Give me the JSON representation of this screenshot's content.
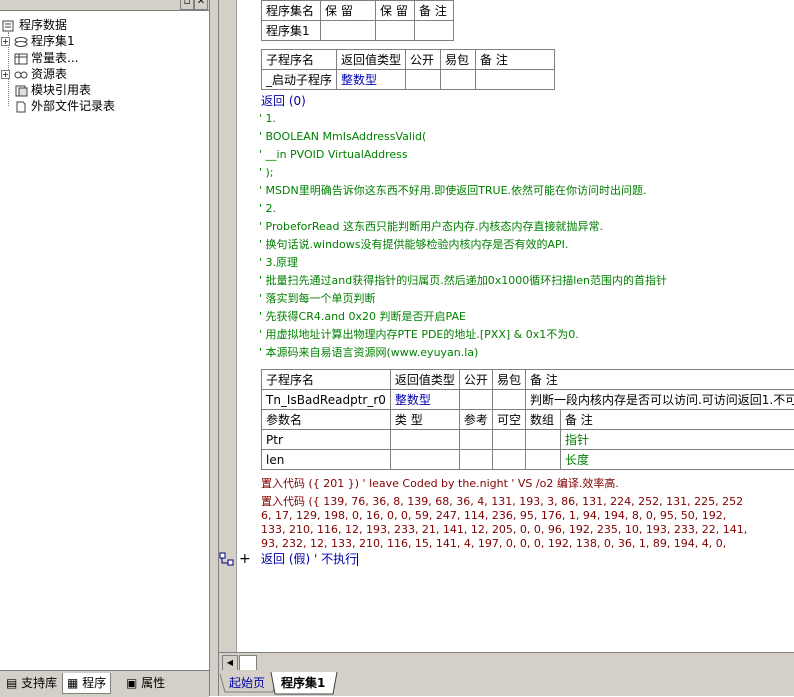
{
  "tree": {
    "root": "程序数据",
    "items": [
      {
        "label": "程序集1",
        "icon": "program-set-icon",
        "expander": "+"
      },
      {
        "label": "常量表...",
        "icon": "constant-table-icon",
        "expander": ""
      },
      {
        "label": "资源表",
        "icon": "resource-table-icon",
        "expander": "+"
      },
      {
        "label": "模块引用表",
        "icon": "module-ref-icon",
        "expander": ""
      },
      {
        "label": "外部文件记录表",
        "icon": "external-file-icon",
        "expander": ""
      }
    ]
  },
  "left_tabs": [
    "支持库",
    "程序",
    "属性"
  ],
  "assembly_table": {
    "headers": [
      "程序集名",
      "保 留",
      "保 留",
      "备 注"
    ],
    "row": [
      "程序集1",
      "",
      "",
      ""
    ]
  },
  "sub1_table": {
    "headers": [
      "子程序名",
      "返回值类型",
      "公开",
      "易包",
      "备 注"
    ],
    "row": [
      "_启动子程序",
      "整数型",
      "",
      "",
      ""
    ]
  },
  "return_line": "返回 (0)",
  "comments": [
    "' 1.",
    "' BOOLEAN MmIsAddressValid(",
    "' __in  PVOID VirtualAddress",
    "' );",
    "' MSDN里明确告诉你这东西不好用.即使返回TRUE.依然可能在你访问时出问题.",
    "' 2.",
    "' ProbeforRead 这东西只能判断用户态内存.内核态内存直接就抛异常.",
    "' 换句话说.windows没有提供能够检验内核内存是否有效的API.",
    "' 3.原理",
    "' 批量扫先通过and获得指针的归属页.然后递加0x1000循环扫描len范围内的首指针",
    "' 落实到每一个单页判断",
    "' 先获得CR4.and 0x20 判断是否开启PAE",
    "' 用虚拟地址计算出物理内存PTE PDE的地址.[PXX] & 0x1不为0.",
    "' 本源码来自易语言资源网(www.eyuyan.la)"
  ],
  "sub2_table": {
    "headers": [
      "子程序名",
      "返回值类型",
      "公开",
      "易包",
      "备 注"
    ],
    "row": [
      "Tn_IsBadReadptr_r0",
      "整数型",
      "",
      "",
      "判断一段内核内存是否可以访问.可访问返回1.不可"
    ],
    "param_headers": [
      "参数名",
      "类 型",
      "参考",
      "可空",
      "数组",
      "备 注"
    ],
    "params": [
      [
        "Ptr",
        "",
        "",
        "",
        "",
        "指针"
      ],
      [
        "len",
        "",
        "",
        "",
        "",
        "长度"
      ]
    ]
  },
  "code": {
    "line1": "置入代码 ({ 201 })  ' leave   Coded by the.night ' VS /o2 编译.效率高.",
    "line2": "置入代码 ({ 139, 76, 36, 8, 139, 68, 36, 4, 131, 193, 3, 86, 131, 224, 252, 131, 225, 252",
    "line3": "6, 17, 129, 198, 0, 16, 0, 0, 59, 247, 114, 236, 95, 176, 1, 94, 194, 8, 0, 95, 50, 192,",
    "line4": "133, 210, 116, 12, 193, 233, 21, 141, 12, 205, 0, 0, 96, 192, 235, 10, 193, 233, 22, 141,",
    "line5": "93, 232, 12, 133, 210, 116, 15, 141, 4, 197, 0, 0, 0, 192, 138, 0, 36, 1, 89, 194, 4, 0,"
  },
  "final_line": "返回 (假)  ' 不执行",
  "doc_tabs": [
    "起始页",
    "程序集1"
  ],
  "colors": {
    "keyword": "#0000aa",
    "comment": "#008000",
    "code": "#800000",
    "panel": "#d4d0c8"
  }
}
